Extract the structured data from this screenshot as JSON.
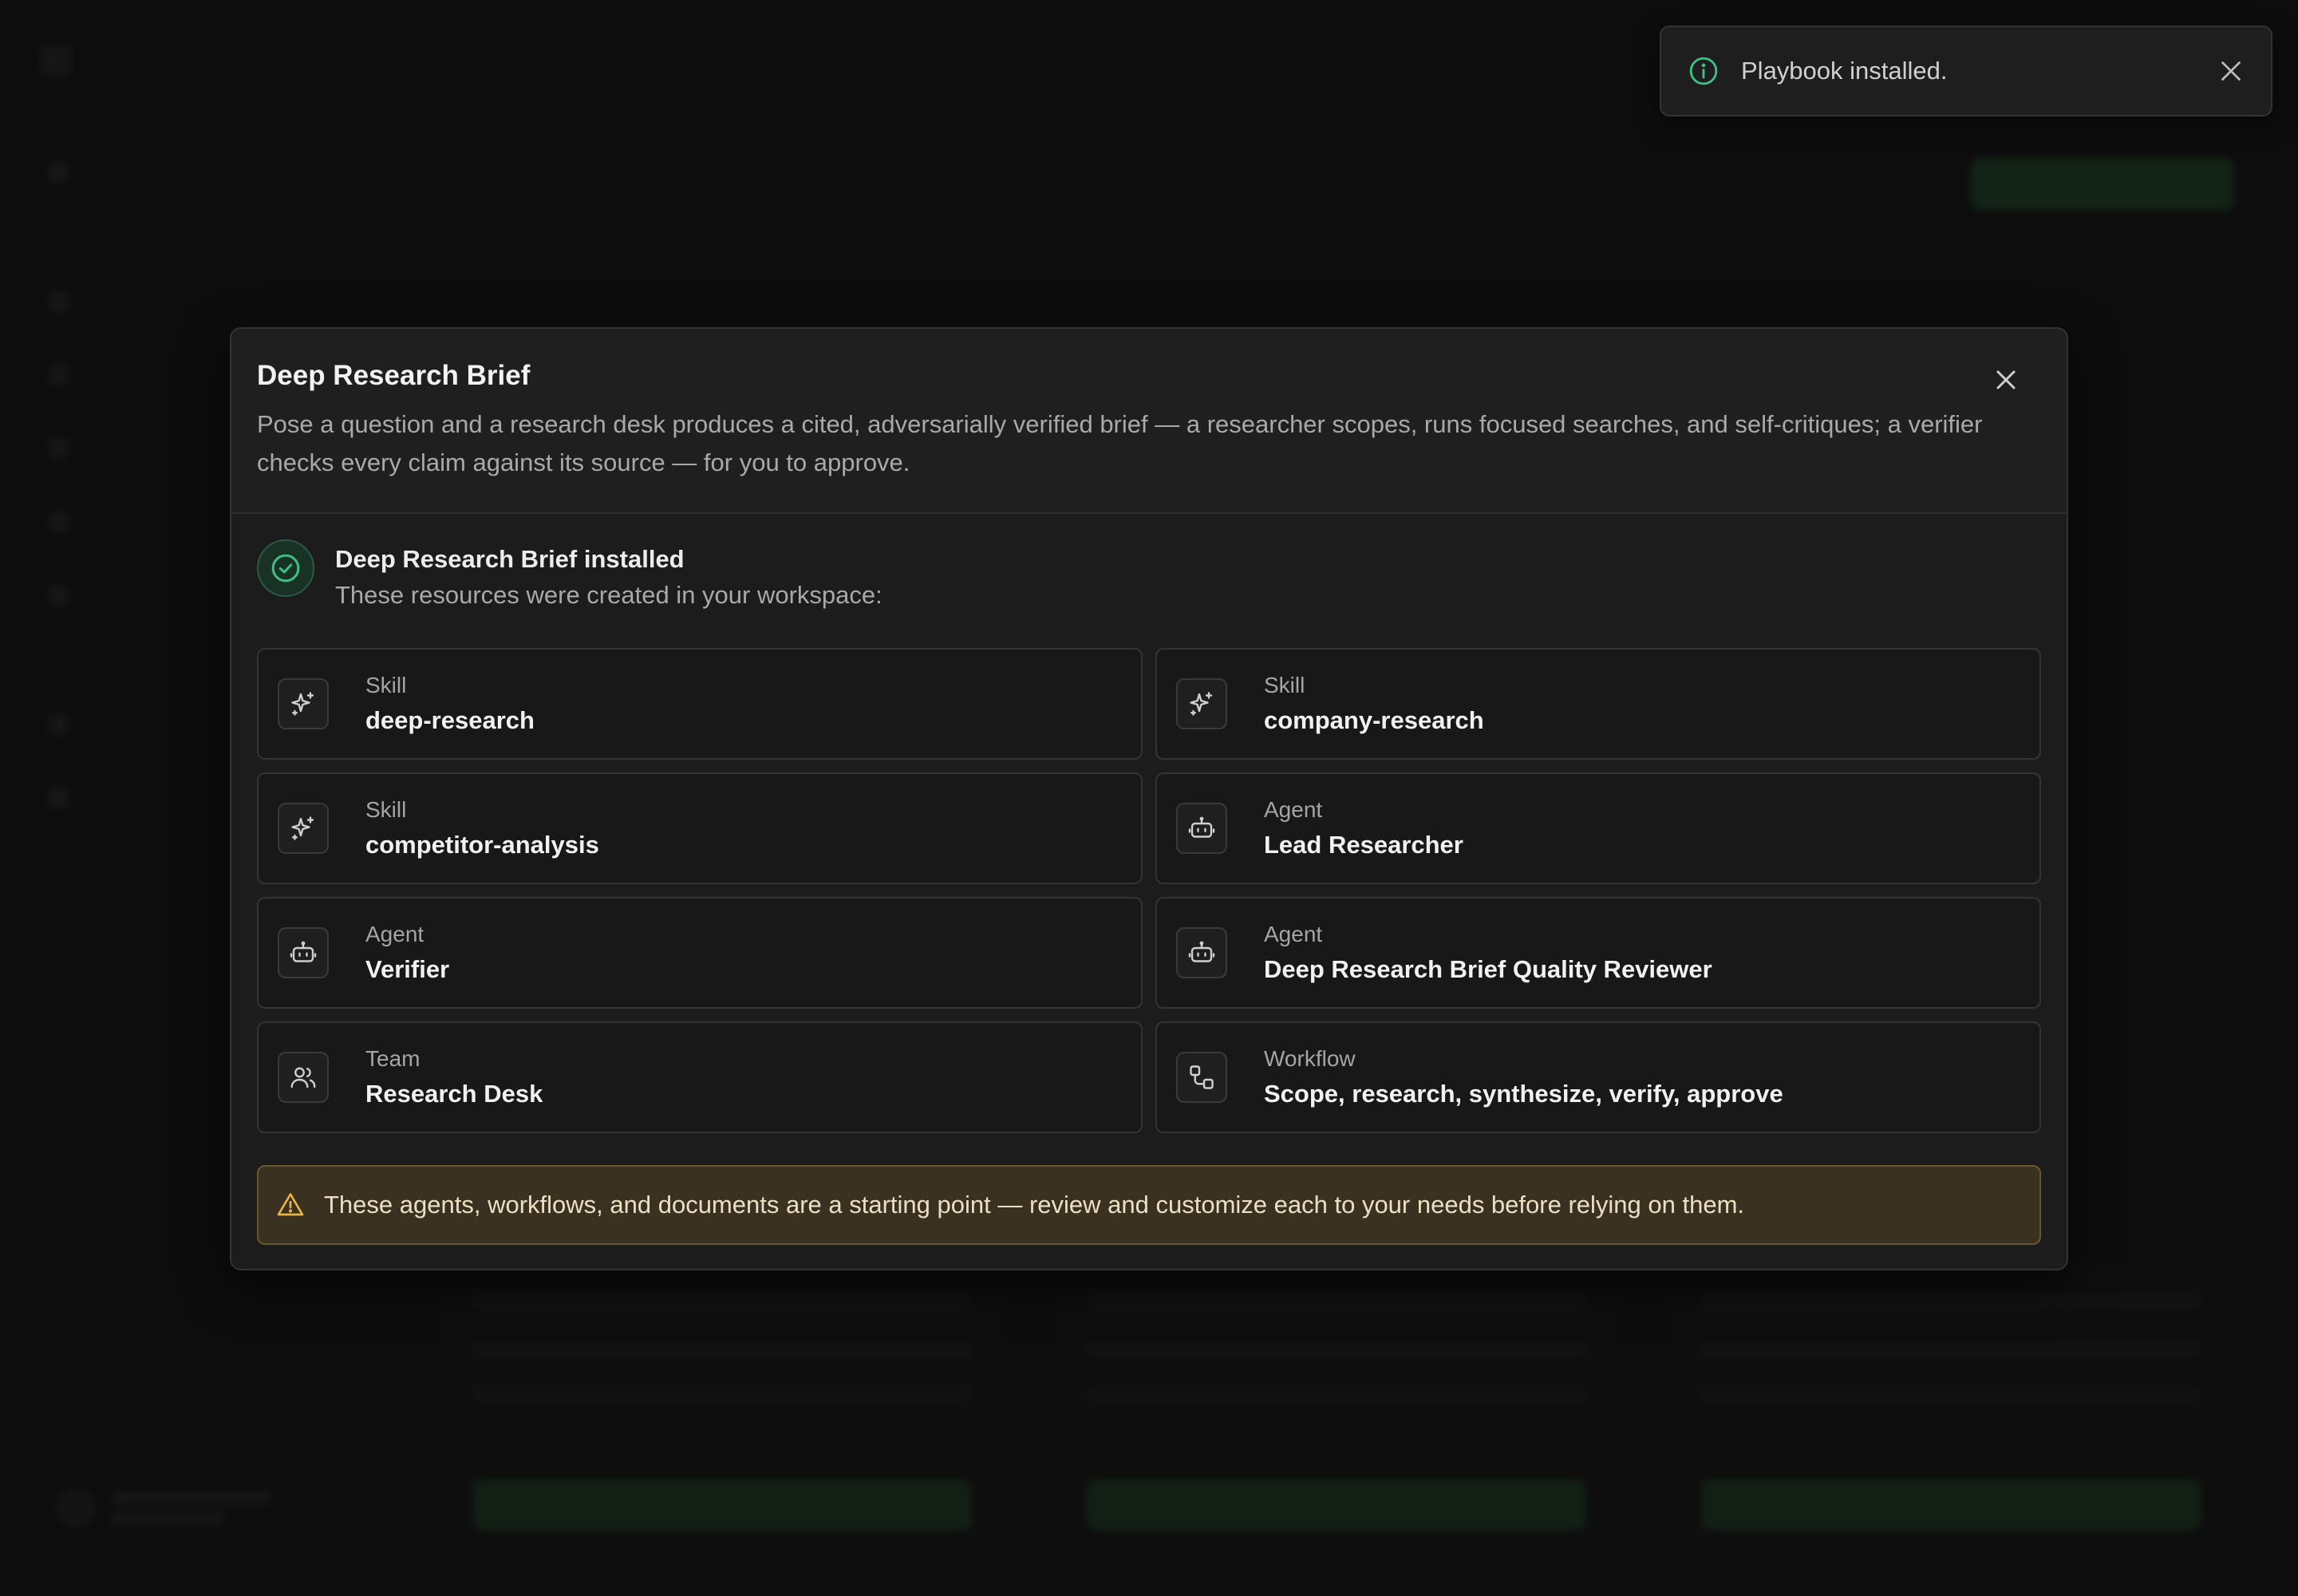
{
  "toast": {
    "message": "Playbook installed.",
    "info_icon": "info-icon",
    "close_icon": "close-icon"
  },
  "modal": {
    "title": "Deep Research Brief",
    "description": "Pose a question and a research desk produces a cited, adversarially verified brief — a researcher scopes, runs focused searches, and self-critiques; a verifier checks every claim against its source — for you to approve.",
    "close_icon": "close-icon",
    "installed": {
      "title": "Deep Research Brief installed",
      "subtitle": "These resources were created in your workspace:"
    },
    "resources": [
      {
        "kind": "Skill",
        "name": "deep-research",
        "icon": "sparkles-icon"
      },
      {
        "kind": "Skill",
        "name": "company-research",
        "icon": "sparkles-icon"
      },
      {
        "kind": "Skill",
        "name": "competitor-analysis",
        "icon": "sparkles-icon"
      },
      {
        "kind": "Agent",
        "name": "Lead Researcher",
        "icon": "bot-icon"
      },
      {
        "kind": "Agent",
        "name": "Verifier",
        "icon": "bot-icon"
      },
      {
        "kind": "Agent",
        "name": "Deep Research Brief Quality Reviewer",
        "icon": "bot-icon"
      },
      {
        "kind": "Team",
        "name": "Research Desk",
        "icon": "users-icon"
      },
      {
        "kind": "Workflow",
        "name": "Scope, research, synthesize, verify, approve",
        "icon": "workflow-icon"
      }
    ],
    "warning": "These agents, workflows, and documents are a starting point — review and customize each to your needs before relying on them."
  },
  "colors": {
    "success": "#3fbf85",
    "warning": "#e6b54a",
    "background": "#141414",
    "surface": "#1c1c1c"
  }
}
